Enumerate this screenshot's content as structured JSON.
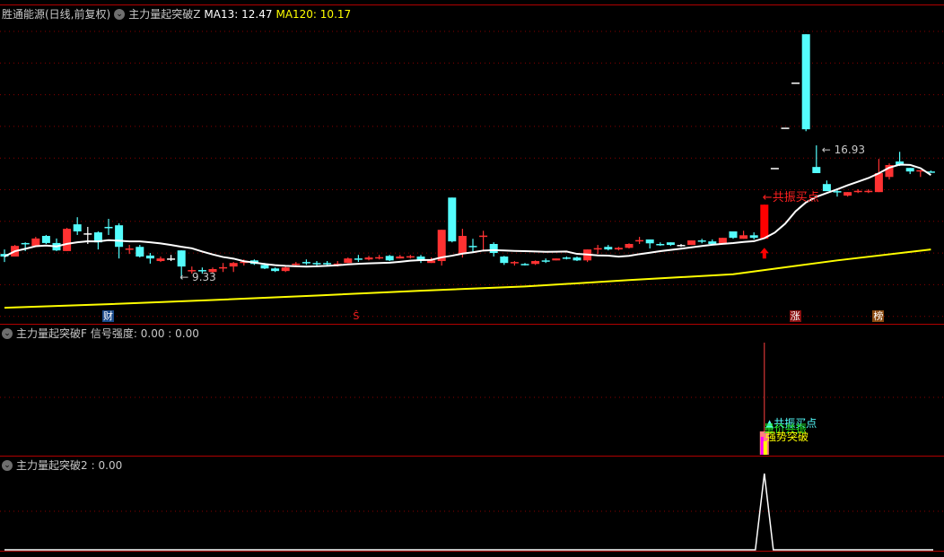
{
  "header": {
    "stock_name": "胜通能源(日线,前复权)",
    "indicator": "主力量起突破Z",
    "ma13_label": "MA13: 12.47",
    "ma120_label": "MA120: 10.17"
  },
  "panel2": {
    "title": "主力量起突破F",
    "value_label": "信号强度: 0.00 : 0.00",
    "signals": [
      "▲共振买点",
      "量价共振",
      "强势突破"
    ]
  },
  "panel3": {
    "title": "主力量起突破2",
    "value_label": ": 0.00"
  },
  "colors": {
    "up": "#ff3232",
    "down": "#54fcfc",
    "flat": "#ffffff",
    "ma13": "#ffffff",
    "ma120": "#ffff00",
    "signal_text": "#ff2020",
    "grid": "#8a0000",
    "divider": "#b00000"
  },
  "chart_data": {
    "type": "candlestick",
    "ylim": [
      7.97,
      17.38
    ],
    "grid": true,
    "candles_ohlc_note_order": [
      "open",
      "close",
      "high",
      "low"
    ],
    "candles": [
      [
        10.11,
        10.03,
        10.25,
        9.86
      ],
      [
        10.03,
        10.36,
        10.39,
        10.03
      ],
      [
        10.45,
        10.42,
        10.47,
        10.2
      ],
      [
        10.36,
        10.59,
        10.64,
        10.33
      ],
      [
        10.67,
        10.45,
        10.7,
        10.42
      ],
      [
        10.45,
        10.22,
        10.59,
        10.2
      ],
      [
        10.2,
        10.89,
        10.92,
        10.2
      ],
      [
        11.03,
        10.81,
        11.25,
        10.7
      ],
      [
        10.75,
        10.75,
        10.95,
        10.42
      ],
      [
        10.78,
        10.47,
        10.81,
        10.25
      ],
      [
        10.95,
        10.92,
        11.2,
        10.7
      ],
      [
        11.0,
        10.33,
        11.06,
        9.97
      ],
      [
        10.25,
        10.28,
        10.39,
        10.11
      ],
      [
        10.33,
        10.03,
        10.39,
        10.0
      ],
      [
        10.06,
        9.97,
        10.14,
        9.81
      ],
      [
        9.89,
        9.97,
        10.03,
        9.86
      ],
      [
        9.97,
        9.97,
        10.08,
        9.89
      ],
      [
        10.22,
        9.72,
        10.22,
        9.33
      ],
      [
        9.58,
        9.61,
        9.72,
        9.5
      ],
      [
        9.61,
        9.58,
        9.69,
        9.5
      ],
      [
        9.55,
        9.64,
        9.69,
        9.53
      ],
      [
        9.69,
        9.7,
        9.83,
        9.55
      ],
      [
        9.72,
        9.83,
        9.86,
        9.55
      ],
      [
        9.86,
        9.87,
        9.94,
        9.75
      ],
      [
        9.91,
        9.8,
        9.94,
        9.77
      ],
      [
        9.77,
        9.66,
        9.83,
        9.64
      ],
      [
        9.66,
        9.58,
        9.69,
        9.55
      ],
      [
        9.58,
        9.69,
        9.72,
        9.55
      ],
      [
        9.8,
        9.81,
        9.86,
        9.72
      ],
      [
        9.86,
        9.85,
        9.94,
        9.77
      ],
      [
        9.83,
        9.82,
        9.89,
        9.75
      ],
      [
        9.83,
        9.82,
        9.89,
        9.75
      ],
      [
        9.8,
        9.81,
        9.89,
        9.72
      ],
      [
        9.83,
        9.97,
        10.0,
        9.83
      ],
      [
        9.97,
        9.96,
        10.08,
        9.86
      ],
      [
        9.94,
        10.0,
        10.05,
        9.91
      ],
      [
        10.0,
        10.01,
        10.08,
        9.94
      ],
      [
        10.05,
        9.91,
        10.08,
        9.89
      ],
      [
        9.97,
        10.03,
        10.08,
        9.97
      ],
      [
        10.03,
        10.04,
        10.08,
        9.97
      ],
      [
        10.03,
        9.91,
        10.08,
        9.83
      ],
      [
        9.83,
        9.91,
        10.0,
        9.83
      ],
      [
        9.89,
        10.86,
        10.86,
        9.75
      ],
      [
        11.86,
        10.5,
        11.86,
        10.47
      ],
      [
        10.11,
        10.67,
        10.89,
        10.0
      ],
      [
        10.36,
        10.33,
        10.58,
        10.16
      ],
      [
        10.67,
        10.68,
        10.83,
        10.19
      ],
      [
        10.42,
        10.14,
        10.47,
        10.03
      ],
      [
        10.03,
        9.83,
        10.05,
        9.77
      ],
      [
        9.83,
        9.86,
        9.89,
        9.75
      ],
      [
        9.8,
        9.79,
        9.83,
        9.75
      ],
      [
        9.8,
        9.89,
        9.91,
        9.77
      ],
      [
        9.91,
        9.9,
        9.97,
        9.83
      ],
      [
        9.91,
        9.97,
        9.97,
        9.91
      ],
      [
        10.0,
        9.99,
        10.03,
        9.94
      ],
      [
        10.0,
        9.91,
        10.03,
        9.89
      ],
      [
        9.91,
        10.25,
        10.25,
        9.86
      ],
      [
        10.28,
        10.29,
        10.39,
        10.11
      ],
      [
        10.33,
        10.25,
        10.39,
        10.22
      ],
      [
        10.25,
        10.3,
        10.33,
        10.22
      ],
      [
        10.3,
        10.42,
        10.44,
        10.28
      ],
      [
        10.53,
        10.54,
        10.64,
        10.42
      ],
      [
        10.56,
        10.44,
        10.56,
        10.28
      ],
      [
        10.42,
        10.41,
        10.47,
        10.36
      ],
      [
        10.47,
        10.39,
        10.47,
        10.36
      ],
      [
        10.39,
        10.39,
        10.42,
        10.33
      ],
      [
        10.39,
        10.53,
        10.53,
        10.39
      ],
      [
        10.53,
        10.52,
        10.58,
        10.44
      ],
      [
        10.5,
        10.42,
        10.56,
        10.39
      ],
      [
        10.42,
        10.61,
        10.61,
        10.42
      ],
      [
        10.81,
        10.61,
        10.81,
        10.58
      ],
      [
        10.58,
        10.69,
        10.83,
        10.58
      ],
      [
        10.69,
        10.61,
        10.78,
        10.56
      ],
      [
        10.58,
        11.64,
        11.64,
        10.58
      ],
      [
        12.78,
        12.78,
        12.78,
        12.78
      ],
      [
        14.03,
        14.03,
        14.03,
        14.03
      ],
      [
        15.43,
        15.43,
        15.43,
        15.43
      ],
      [
        16.93,
        13.98,
        16.93,
        13.92
      ],
      [
        12.81,
        12.62,
        13.48,
        12.62
      ],
      [
        12.28,
        12.06,
        12.39,
        12.06
      ],
      [
        12.06,
        12.05,
        12.14,
        11.89
      ],
      [
        11.92,
        12.03,
        12.03,
        11.89
      ],
      [
        12.06,
        12.07,
        12.12,
        12.0
      ],
      [
        12.06,
        12.07,
        12.12,
        12.0
      ],
      [
        12.03,
        12.62,
        13.06,
        12.03
      ],
      [
        12.5,
        12.87,
        12.92,
        12.42
      ],
      [
        12.98,
        12.87,
        13.28,
        12.84
      ],
      [
        12.78,
        12.67,
        12.78,
        12.59
      ],
      [
        12.7,
        12.71,
        12.71,
        12.5
      ],
      [
        12.67,
        12.66,
        12.7,
        12.64
      ]
    ],
    "ma13_period": 13,
    "ma120_points": [
      {
        "i": 0,
        "v": 8.44
      },
      {
        "i": 10,
        "v": 8.55
      },
      {
        "i": 20,
        "v": 8.68
      },
      {
        "i": 30,
        "v": 8.82
      },
      {
        "i": 40,
        "v": 8.97
      },
      {
        "i": 50,
        "v": 9.1
      },
      {
        "i": 60,
        "v": 9.3
      },
      {
        "i": 70,
        "v": 9.48
      },
      {
        "i": 80,
        "v": 9.91
      },
      {
        "i": 89,
        "v": 10.25
      }
    ],
    "high_label": "16.93",
    "low_label": "9.33",
    "high_index": 78,
    "low_index": 17,
    "buy_signal": {
      "index": 73,
      "label": "←共振买点"
    },
    "markers": [
      {
        "index": 10,
        "text": "财",
        "bg": "#1a4a8a",
        "color": "#ffffff"
      },
      {
        "index": 34,
        "text": "Ŝ",
        "bg": "transparent",
        "color": "#ff2020"
      },
      {
        "index": 76,
        "text": "涨",
        "bg": "#8a1010",
        "color": "#ffffff"
      },
      {
        "index": 84,
        "text": "榜",
        "bg": "#8a4a10",
        "color": "#ffffff"
      }
    ],
    "signal_index": 73,
    "signal_value": 1
  }
}
